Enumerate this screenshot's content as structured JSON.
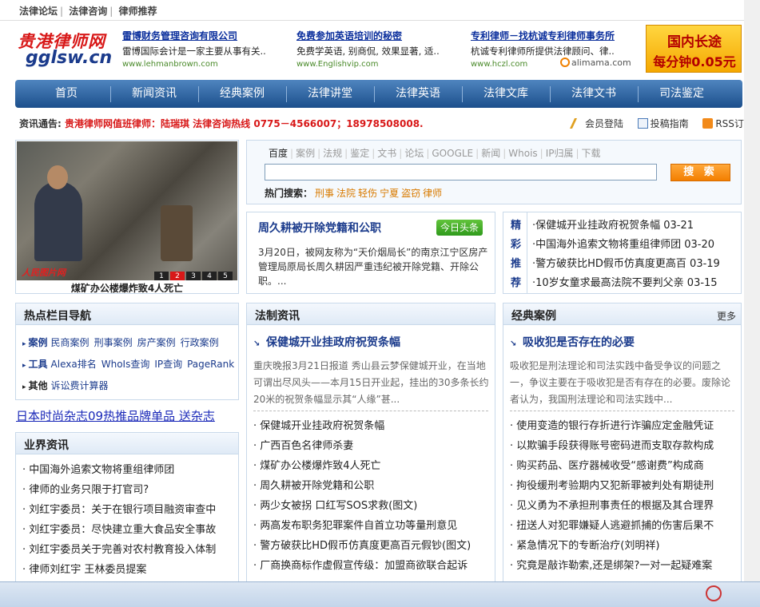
{
  "topbar": {
    "links": [
      "法律论坛",
      "法律咨询",
      "律师推荐"
    ],
    "sep": "|"
  },
  "logo": {
    "cn": "贵港律师网",
    "en": "gglsw.cn"
  },
  "ads": [
    {
      "title": "雷博财务管理咨询有限公司",
      "desc": "雷博国际会计是一家主要从事有关..",
      "url": "www.lehmanbrown.com"
    },
    {
      "title": "免费参加英语培训的秘密",
      "desc": "免费学英语, 别商侃, 效果显著, 适..",
      "url": "www.Englishvip.com"
    },
    {
      "title": "专利律师－找杭诚专利律师事务所",
      "desc": "杭诚专利律师所提供法律顾问、律..",
      "url": "www.hczl.com"
    }
  ],
  "alimama": "alimama.com",
  "banner": {
    "line1": "国内长途",
    "line2": "每分钟0.05元"
  },
  "nav": [
    "首页",
    "新闻资讯",
    "经典案例",
    "法律讲堂",
    "法律英语",
    "法律文库",
    "法律文书",
    "司法鉴定"
  ],
  "notice": {
    "label": "资讯通告:",
    "red": "贵港律师网值班律师：陆瑞琪  法律咨询热线 0775－4566007；18978508008."
  },
  "toplinks": {
    "login": "会员登陆",
    "guide": "投稿指南",
    "rss": "RSS订阅"
  },
  "photo": {
    "logo": "人民图片网",
    "pages": [
      "1",
      "2",
      "3",
      "4",
      "5"
    ],
    "active_page": "2",
    "caption": "煤矿办公楼爆炸致4人死亡"
  },
  "search": {
    "tabs": [
      "百度",
      "案例",
      "法规",
      "鉴定",
      "文书",
      "论坛",
      "GOOGLE",
      "新闻",
      "Whois",
      "IP归属",
      "下载"
    ],
    "active_tab": "百度",
    "value": "",
    "button": "搜 索",
    "hot_label": "热门搜索：",
    "hot_keywords": [
      "刑事",
      "法院",
      "轻伤",
      "宁夏",
      "盗窃",
      "律师"
    ]
  },
  "headline": {
    "title": "周久耕被开除党籍和公职",
    "badge": "今日头条",
    "body": "3月20日，被网友称为“天价烟局长”的南京江宁区房产管理局原局长周久耕因严重违纪被开除党籍、开除公职。..."
  },
  "jingcai": {
    "label": [
      "精",
      "彩",
      "推",
      "荐"
    ],
    "items": [
      "·保健城开业挂政府祝贺条幅 03-21",
      "·中国海外追索文物将重组律师团 03-20",
      "·警方破获比HD假币仿真度更高百 03-19",
      "·10岁女童求最高法院不要判父亲 03-15"
    ]
  },
  "hotnav": {
    "title": "热点栏目导航",
    "rows": [
      {
        "key": "案例",
        "links": [
          "民商案例",
          "刑事案例",
          "房产案例",
          "行政案例"
        ]
      },
      {
        "key": "工具",
        "links": [
          "Alexa排名",
          "WhoIs查询",
          "IP查询",
          "PageRank"
        ]
      },
      {
        "key": "其他",
        "links": [
          "诉讼费计算器"
        ]
      }
    ]
  },
  "promo": "日本时尚杂志09热推品牌单品 送杂志",
  "industry": {
    "title": "业界资讯",
    "items": [
      "· 中国海外追索文物将重组律师团",
      "· 律师的业务只限于打官司?",
      "· 刘红宇委员：关于在银行项目融资审查中",
      "· 刘红宇委员：尽快建立重大食品安全事故",
      "· 刘红宇委员关于完善对农村教育投入体制",
      "· 律师刘红宇 王林委员提案"
    ]
  },
  "fazhi": {
    "title": "法制资讯",
    "lead": "保健城开业挂政府祝贺条幅",
    "summary": "重庆晚报3月21日报道 秀山县云梦保健城开业，在当地可谓出尽风头——本月15日开业起，挂出的30多条长约20米的祝贺条幅显示其“人缘”甚...",
    "items": [
      "· 保健城开业挂政府祝贺条幅",
      "· 广西百色名律师杀妻",
      "· 煤矿办公楼爆炸致4人死亡",
      "· 周久耕被开除党籍和公职",
      "· 两少女被拐 口红写SOS求救(图文)",
      "· 两高发布职务犯罪案件自首立功等量刑意见",
      "· 警方破获比HD假币仿真度更高百元假钞(图文)",
      "· 厂商换商标作虚假宣传级：加盟商欲联合起诉"
    ]
  },
  "anli": {
    "title": "经典案例",
    "more": "更多",
    "lead": "吸收犯是否存在的必要",
    "summary": "吸收犯是刑法理论和司法实践中备受争议的问题之一，争议主要在于吸收犯是否有存在的必要。废除论者认为，我国刑法理论和司法实践中...",
    "items": [
      "· 使用变造的银行存折进行诈骗应定金融凭证",
      "· 以欺骗手段获得账号密码进而支取存款构成",
      "· 购买药品、医疗器械收受“感谢费”构成商",
      "· 拘役缓刑考验期内又犯新罪被判处有期徒刑",
      "· 见义勇为不承担刑事责任的根据及其合理界",
      "· 扭送人对犯罪嫌疑人逃避抓捕的伤害后果不",
      "· 紧急情况下的专断治疗(刘明祥)",
      "· 究竟是敲诈勒索,还是绑架?一对一起疑难案"
    ]
  }
}
